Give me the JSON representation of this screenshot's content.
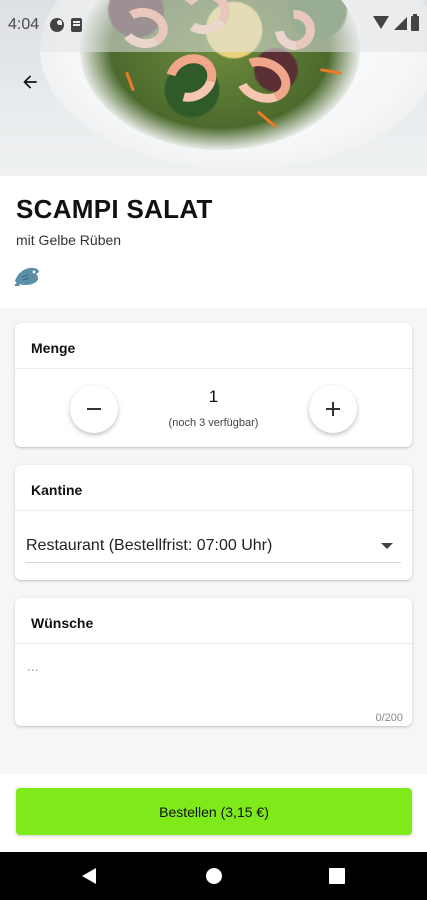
{
  "status_bar": {
    "time": "4:04"
  },
  "product": {
    "title": "SCAMPI SALAT",
    "subtitle": "mit Gelbe Rüben",
    "category_icon": "fish-icon"
  },
  "quantity": {
    "header": "Menge",
    "value": "1",
    "availability": "(noch 3 verfügbar)"
  },
  "canteen": {
    "header": "Kantine",
    "selected": "Restaurant (Bestellfrist: 07:00 Uhr)"
  },
  "wishes": {
    "header": "Wünsche",
    "placeholder": "...",
    "counter": "0/200"
  },
  "order_button": {
    "label": "Bestellen (3,15 €)"
  },
  "colors": {
    "accent_green": "#7fea1a",
    "fish_icon": "#5b8fa8"
  }
}
